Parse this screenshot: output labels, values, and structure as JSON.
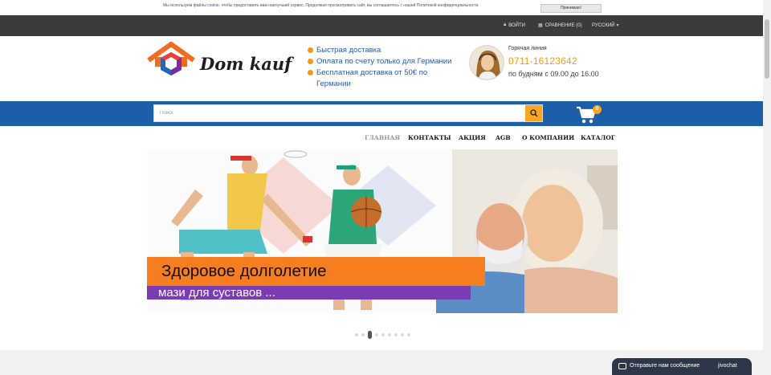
{
  "cookie_bar": {
    "text_before": "Мы используем файлы ",
    "cookie_link": "cookie",
    "text_after": ", чтобы предоставить вам наилучший сервис. Продолжая просматривать сайт, вы соглашаетесь с нашей Политикой конфиденциальности.",
    "accept_label": "Принимаю!"
  },
  "topbar": {
    "login": "ВОЙТИ",
    "compare": "СРАВНЕНИЕ (0)",
    "language": "РУССКИЙ"
  },
  "header": {
    "logo_text": "Dom kauf",
    "features": [
      "Быстрая доставка",
      "Оплата по счету только для Германии",
      "Бесплатная доставка от 50€ по Германии"
    ],
    "hotline_label": "Горячая линия",
    "hotline_phone": "0711-16123642",
    "hotline_hours": "по будням с 09.00 до 16.00"
  },
  "search": {
    "placeholder": "Поиск",
    "cart_count": "0"
  },
  "nav": {
    "items": [
      "ГЛАВНАЯ",
      "КОНТАКТЫ",
      "АКЦИЯ",
      "AGB",
      "О КОМПАНИИ",
      "КАТАЛОГ"
    ]
  },
  "banner": {
    "title": "Здоровое долголетие",
    "subtitle": "мази для суставов ..."
  },
  "carousel": {
    "slides": 9,
    "active": 1
  },
  "chat": {
    "label": "Отправьте нам сообщение",
    "brand": "jivochat"
  },
  "colors": {
    "accent": "#f39c12",
    "brand_blue": "#1d5ea8",
    "topbar": "#3a3b3d",
    "banner_orange": "#f57e20",
    "banner_purple": "#7a3bb3"
  }
}
